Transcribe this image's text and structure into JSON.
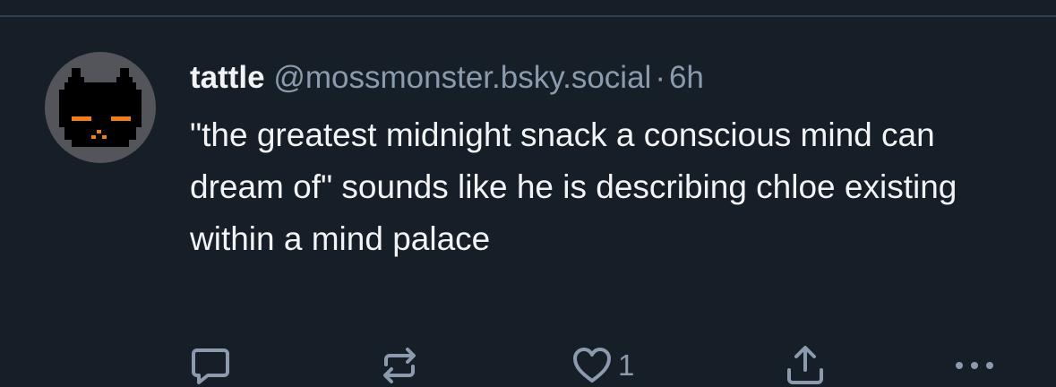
{
  "post": {
    "display_name": "tattle",
    "handle": "@mossmonster.bsky.social",
    "separator": "·",
    "time": "6h",
    "text": "\"the greatest midnight snack a conscious mind can dream of\" sounds like he is describing chloe existing within a mind palace",
    "avatar_icon": "black-cat-avatar"
  },
  "actions": {
    "reply_icon": "speech-bubble-icon",
    "repost_icon": "repost-arrows-icon",
    "like_icon": "heart-icon",
    "like_count": "1",
    "share_icon": "share-upload-icon",
    "more_icon": "ellipsis-icon"
  },
  "colors": {
    "background": "#161e27",
    "divider": "#2e4052",
    "primary_text": "#f1f3f5",
    "secondary_text": "#8b9bad",
    "accent_eyes": "#f07f1a"
  }
}
